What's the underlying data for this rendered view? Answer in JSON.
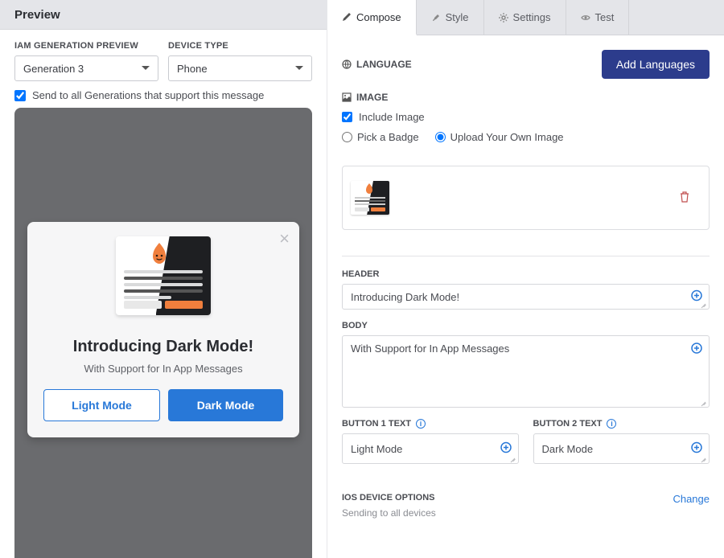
{
  "left": {
    "title": "Preview",
    "generation_label": "IAM GENERATION PREVIEW",
    "generation_value": "Generation 3",
    "device_label": "DEVICE TYPE",
    "device_value": "Phone",
    "send_all_label": "Send to all Generations that support this message"
  },
  "modal": {
    "header": "Introducing Dark Mode!",
    "body": "With Support for In App Messages",
    "btn1": "Light Mode",
    "btn2": "Dark Mode"
  },
  "tabs": {
    "compose": "Compose",
    "style": "Style",
    "settings": "Settings",
    "test": "Test"
  },
  "compose": {
    "language_title": "LANGUAGE",
    "add_languages": "Add Languages",
    "image_title": "IMAGE",
    "include_image": "Include Image",
    "pick_badge": "Pick a Badge",
    "upload_own": "Upload Your Own Image",
    "header_label": "HEADER",
    "header_value": "Introducing Dark Mode!",
    "body_label": "BODY",
    "body_value": "With Support for In App Messages",
    "btn1_label": "BUTTON 1 TEXT",
    "btn1_value": "Light Mode",
    "btn2_label": "BUTTON 2 TEXT",
    "btn2_value": "Dark Mode",
    "ios_title": "IOS DEVICE OPTIONS",
    "ios_sub": "Sending to all devices",
    "change": "Change"
  }
}
